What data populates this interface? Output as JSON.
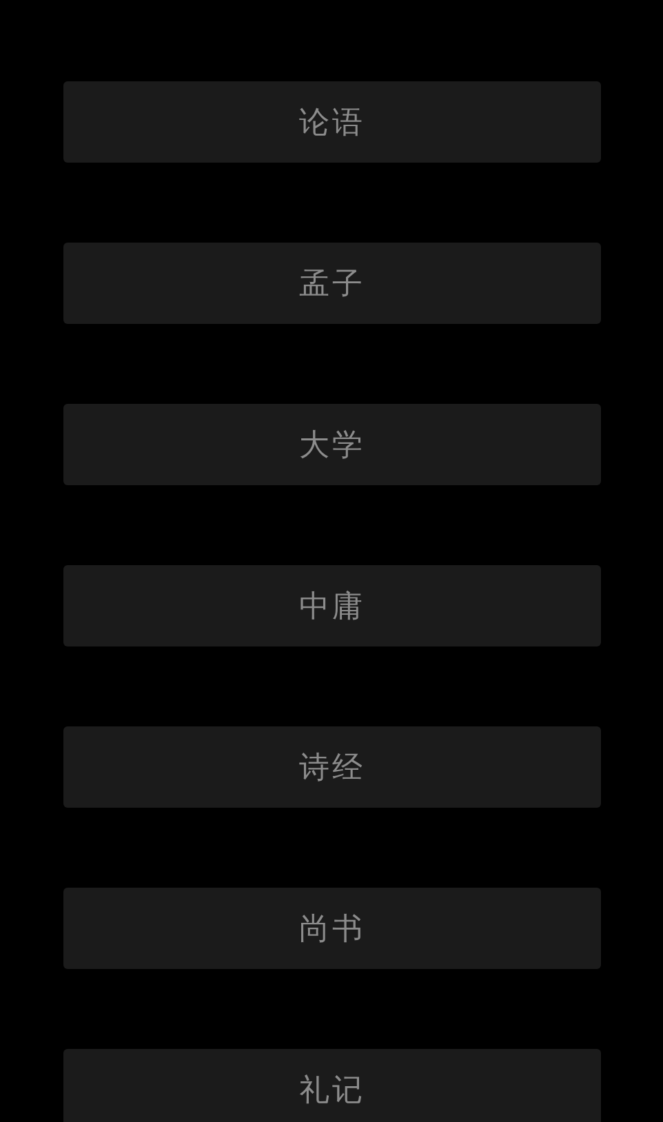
{
  "books": [
    {
      "label": "论语"
    },
    {
      "label": "孟子"
    },
    {
      "label": "大学"
    },
    {
      "label": "中庸"
    },
    {
      "label": "诗经"
    },
    {
      "label": "尚书"
    },
    {
      "label": "礼记"
    }
  ]
}
